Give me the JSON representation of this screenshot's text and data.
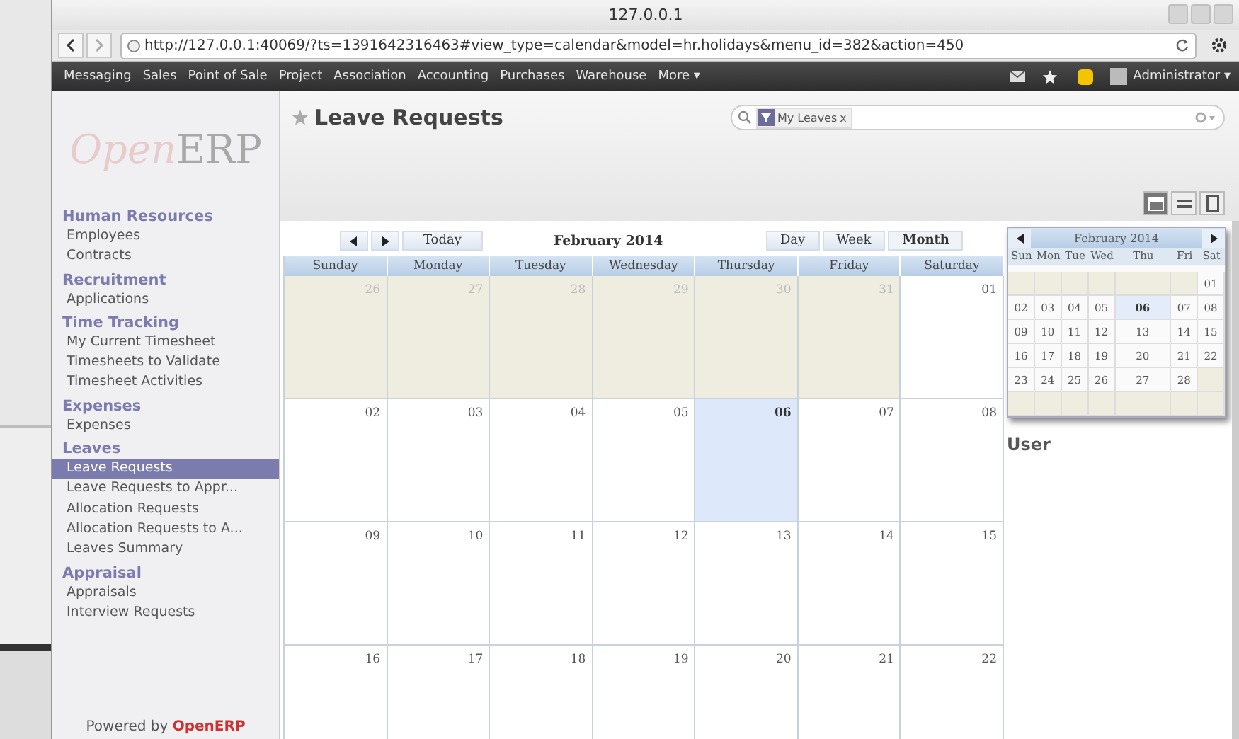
{
  "window": {
    "title": "127.0.0.1"
  },
  "address_bar": {
    "url": "http://127.0.0.1:40069/?ts=1391642316463#view_type=calendar&model=hr.holidays&menu_id=382&action=450"
  },
  "top_menu": {
    "items": [
      "Messaging",
      "Sales",
      "Point of Sale",
      "Project",
      "Association",
      "Accounting",
      "Purchases",
      "Warehouse",
      "More ▾"
    ],
    "user": "Administrator ▾"
  },
  "logo": {
    "first": "Open",
    "second": "ERP"
  },
  "sidebar": {
    "sections": [
      {
        "title": "Human Resources",
        "items": [
          {
            "label": "Employees",
            "selected": false
          },
          {
            "label": "Contracts",
            "selected": false
          }
        ]
      },
      {
        "title": "Recruitment",
        "items": [
          {
            "label": "Applications",
            "selected": false
          }
        ]
      },
      {
        "title": "Time Tracking",
        "items": [
          {
            "label": "My Current Timesheet",
            "selected": false
          },
          {
            "label": "Timesheets to Validate",
            "selected": false
          },
          {
            "label": "Timesheet Activities",
            "selected": false
          }
        ]
      },
      {
        "title": "Expenses",
        "items": [
          {
            "label": "Expenses",
            "selected": false
          }
        ]
      },
      {
        "title": "Leaves",
        "items": [
          {
            "label": "Leave Requests",
            "selected": true
          },
          {
            "label": "Leave Requests to Appr...",
            "selected": false
          },
          {
            "label": "Allocation Requests",
            "selected": false
          },
          {
            "label": "Allocation Requests to A...",
            "selected": false
          },
          {
            "label": "Leaves Summary",
            "selected": false
          }
        ]
      },
      {
        "title": "Appraisal",
        "items": [
          {
            "label": "Appraisals",
            "selected": false
          },
          {
            "label": "Interview Requests",
            "selected": false
          }
        ]
      }
    ],
    "footer": {
      "text": "Powered by",
      "brand": "OpenERP"
    }
  },
  "page": {
    "title": "Leave Requests",
    "search_facets": [
      {
        "label": "My Leaves",
        "remove": "x"
      }
    ],
    "views": [
      {
        "kind": "calendar",
        "selected": true
      },
      {
        "kind": "list",
        "selected": false
      },
      {
        "kind": "form",
        "selected": false
      }
    ]
  },
  "calendar": {
    "title": "February 2014",
    "today_button": "Today",
    "modes": [
      {
        "label": "Day",
        "selected": false
      },
      {
        "label": "Week",
        "selected": false
      },
      {
        "label": "Month",
        "selected": true
      }
    ],
    "weekdays": [
      "Sunday",
      "Monday",
      "Tuesday",
      "Wednesday",
      "Thursday",
      "Friday",
      "Saturday"
    ],
    "weeks": [
      [
        {
          "label": "26",
          "other_month": true,
          "today": false
        },
        {
          "label": "27",
          "other_month": true,
          "today": false
        },
        {
          "label": "28",
          "other_month": true,
          "today": false
        },
        {
          "label": "29",
          "other_month": true,
          "today": false
        },
        {
          "label": "30",
          "other_month": true,
          "today": false
        },
        {
          "label": "31",
          "other_month": true,
          "today": false
        },
        {
          "label": "01",
          "other_month": false,
          "today": false
        }
      ],
      [
        {
          "label": "02",
          "other_month": false,
          "today": false
        },
        {
          "label": "03",
          "other_month": false,
          "today": false
        },
        {
          "label": "04",
          "other_month": false,
          "today": false
        },
        {
          "label": "05",
          "other_month": false,
          "today": false
        },
        {
          "label": "06",
          "other_month": false,
          "today": true
        },
        {
          "label": "07",
          "other_month": false,
          "today": false
        },
        {
          "label": "08",
          "other_month": false,
          "today": false
        }
      ],
      [
        {
          "label": "09",
          "other_month": false,
          "today": false
        },
        {
          "label": "10",
          "other_month": false,
          "today": false
        },
        {
          "label": "11",
          "other_month": false,
          "today": false
        },
        {
          "label": "12",
          "other_month": false,
          "today": false
        },
        {
          "label": "13",
          "other_month": false,
          "today": false
        },
        {
          "label": "14",
          "other_month": false,
          "today": false
        },
        {
          "label": "15",
          "other_month": false,
          "today": false
        }
      ],
      [
        {
          "label": "16",
          "other_month": false,
          "today": false
        },
        {
          "label": "17",
          "other_month": false,
          "today": false
        },
        {
          "label": "18",
          "other_month": false,
          "today": false
        },
        {
          "label": "19",
          "other_month": false,
          "today": false
        },
        {
          "label": "20",
          "other_month": false,
          "today": false
        },
        {
          "label": "21",
          "other_month": false,
          "today": false
        },
        {
          "label": "22",
          "other_month": false,
          "today": false
        }
      ]
    ]
  },
  "mini_calendar": {
    "title": "February 2014",
    "weekdays": [
      "Sun",
      "Mon",
      "Tue",
      "Wed",
      "Thu",
      "Fri",
      "Sat"
    ],
    "weeks": [
      [
        {
          "kind": "blank"
        },
        {
          "kind": "blank"
        },
        {
          "kind": "blank"
        },
        {
          "kind": "blank"
        },
        {
          "kind": "blank"
        },
        {
          "kind": "blank"
        },
        {
          "kind": "day",
          "label": "01",
          "today": false
        }
      ],
      [
        {
          "kind": "day",
          "label": "02",
          "today": false
        },
        {
          "kind": "day",
          "label": "03",
          "today": false
        },
        {
          "kind": "day",
          "label": "04",
          "today": false
        },
        {
          "kind": "day",
          "label": "05",
          "today": false
        },
        {
          "kind": "day",
          "label": "06",
          "today": true
        },
        {
          "kind": "day",
          "label": "07",
          "today": false
        },
        {
          "kind": "day",
          "label": "08",
          "today": false
        }
      ],
      [
        {
          "kind": "day",
          "label": "09",
          "today": false
        },
        {
          "kind": "day",
          "label": "10",
          "today": false
        },
        {
          "kind": "day",
          "label": "11",
          "today": false
        },
        {
          "kind": "day",
          "label": "12",
          "today": false
        },
        {
          "kind": "day",
          "label": "13",
          "today": false
        },
        {
          "kind": "day",
          "label": "14",
          "today": false
        },
        {
          "kind": "day",
          "label": "15",
          "today": false
        }
      ],
      [
        {
          "kind": "day",
          "label": "16",
          "today": false
        },
        {
          "kind": "day",
          "label": "17",
          "today": false
        },
        {
          "kind": "day",
          "label": "18",
          "today": false
        },
        {
          "kind": "day",
          "label": "19",
          "today": false
        },
        {
          "kind": "day",
          "label": "20",
          "today": false
        },
        {
          "kind": "day",
          "label": "21",
          "today": false
        },
        {
          "kind": "day",
          "label": "22",
          "today": false
        }
      ],
      [
        {
          "kind": "day",
          "label": "23",
          "today": false
        },
        {
          "kind": "day",
          "label": "24",
          "today": false
        },
        {
          "kind": "day",
          "label": "25",
          "today": false
        },
        {
          "kind": "day",
          "label": "26",
          "today": false
        },
        {
          "kind": "day",
          "label": "27",
          "today": false
        },
        {
          "kind": "day",
          "label": "28",
          "today": false
        },
        {
          "kind": "blank"
        }
      ],
      [
        {
          "kind": "blank"
        },
        {
          "kind": "blank"
        },
        {
          "kind": "blank"
        },
        {
          "kind": "blank"
        },
        {
          "kind": "blank"
        },
        {
          "kind": "blank"
        },
        {
          "kind": "blank"
        }
      ]
    ]
  },
  "filter_panel": {
    "title": "User"
  }
}
